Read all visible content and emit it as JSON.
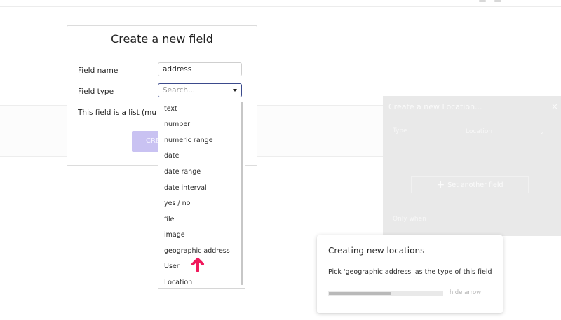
{
  "modal": {
    "title": "Create a new field",
    "field_name_label": "Field name",
    "field_name_value": "address",
    "field_type_label": "Field type",
    "field_type_placeholder": "Search...",
    "is_list_label": "This field is a list (multip",
    "create_button_label": "CRE"
  },
  "dropdown": {
    "items": [
      "text",
      "number",
      "numeric range",
      "date",
      "date range",
      "date interval",
      "yes / no",
      "file",
      "image",
      "geographic address",
      "User",
      "Location"
    ]
  },
  "side_panel": {
    "title": "Create a new Location...",
    "close_glyph": "×",
    "type_label": "Type",
    "type_value": "Location",
    "type_caret": "⌄",
    "set_field_button": "Set another field",
    "plus_glyph": "+",
    "only_when_label": "Only when"
  },
  "tooltip": {
    "title": "Creating new locations",
    "body": "Pick 'geographic address' as the type of this field",
    "progress": 0.55,
    "hide_label": "hide arrow"
  },
  "icons": {
    "arrow": "arrow-up-icon",
    "caret": "chevron-down-icon",
    "close": "close-icon"
  },
  "colors": {
    "arrow": "#f0195c",
    "focus_border": "#3b4a8c",
    "create_button": "#c9c2f2",
    "panel_bg": "#e9e9e9"
  }
}
